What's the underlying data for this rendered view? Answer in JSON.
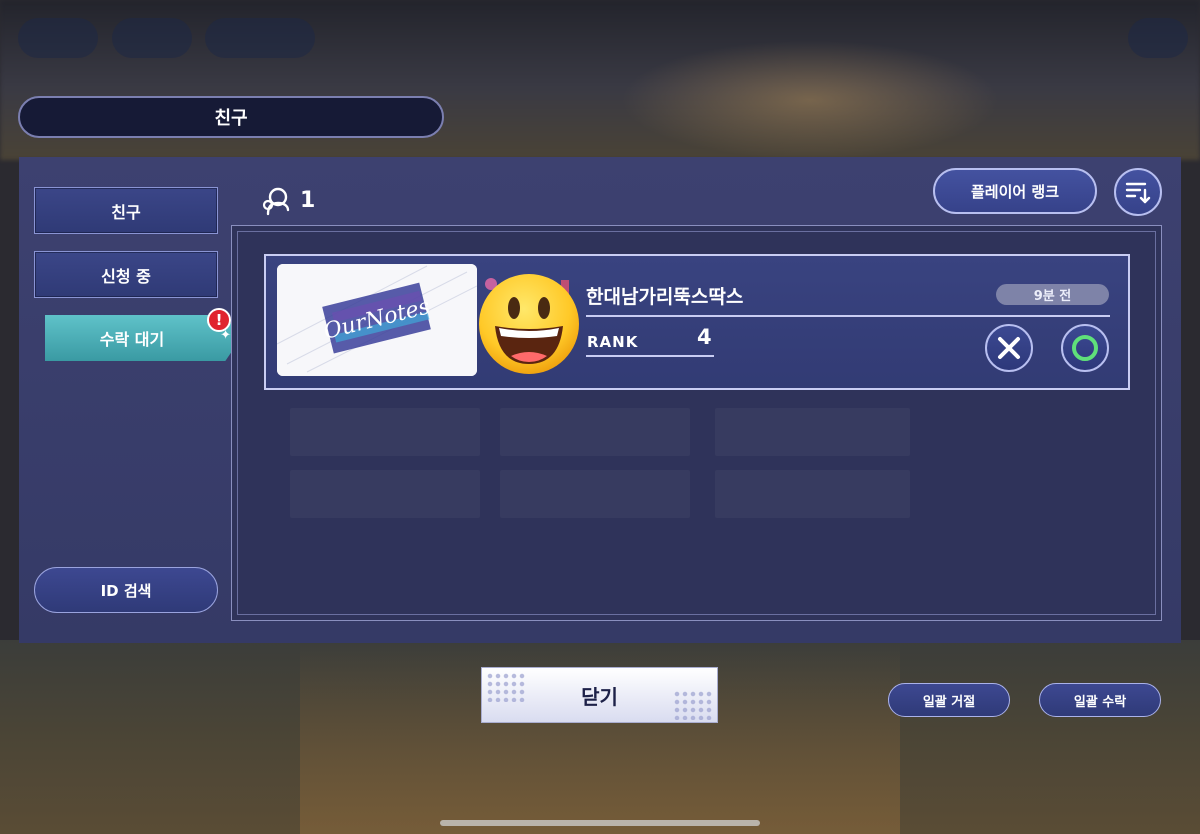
{
  "header": {
    "title": "친구"
  },
  "sidebar": {
    "tabs": [
      {
        "label": "친구"
      },
      {
        "label": "신청 중"
      },
      {
        "label": "수락 대기"
      }
    ],
    "id_search_label": "ID 검색"
  },
  "toolbar": {
    "count": "1",
    "player_rank_label": "플레이어 랭크"
  },
  "requests": [
    {
      "name": "한대남가리뚝스딱스",
      "time": "9분 전",
      "rank_label": "RANK",
      "rank": "4"
    }
  ],
  "footer": {
    "close_label": "닫기",
    "reject_all_label": "일괄 거절",
    "accept_all_label": "일괄 수락"
  },
  "colors": {
    "panel": "#3d4170",
    "active_tab": "#5fc2c9",
    "alert": "#e0242f",
    "accept_ring": "#5fe07a"
  }
}
